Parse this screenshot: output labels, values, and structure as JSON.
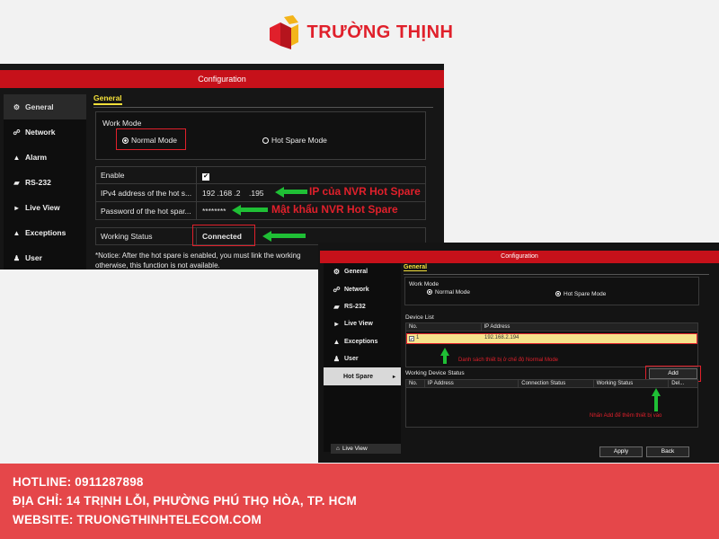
{
  "brand": {
    "name": "TRƯỜNG THỊNH",
    "colors": {
      "primary": "#e0202b",
      "accent": "#f3b41a"
    }
  },
  "shot1": {
    "title": "Configuration",
    "sidebar": [
      {
        "icon": "gear-icon",
        "label": "General"
      },
      {
        "icon": "network-icon",
        "label": "Network"
      },
      {
        "icon": "alarm-icon",
        "label": "Alarm"
      },
      {
        "icon": "serial-icon",
        "label": "RS-232"
      },
      {
        "icon": "liveview-icon",
        "label": "Live View"
      },
      {
        "icon": "warning-icon",
        "label": "Exceptions"
      },
      {
        "icon": "user-icon",
        "label": "User"
      }
    ],
    "tab": "General",
    "work_mode_label": "Work Mode",
    "normal_mode": "Normal Mode",
    "hot_spare_mode": "Hot Spare Mode",
    "rows": [
      {
        "key": "Enable",
        "value": "✔"
      },
      {
        "key": "IPv4 address of the hot s...",
        "value": "192 .168 .2    .195"
      },
      {
        "key": "Password of the hot spar...",
        "value": "********"
      }
    ],
    "working_status_label": "Working Status",
    "working_status_value": "Connected",
    "notice": "*Notice: After the hot spare is enabled, you must link the working\notherwise, this function is not available.",
    "annotations": {
      "ip": "IP của NVR Hot Spare",
      "password": "Mật khẩu NVR Hot Spare"
    }
  },
  "shot2": {
    "title": "Configuration",
    "sidebar": [
      {
        "icon": "gear-icon",
        "label": "General"
      },
      {
        "icon": "network-icon",
        "label": "Network"
      },
      {
        "icon": "serial-icon",
        "label": "RS-232"
      },
      {
        "icon": "liveview-icon",
        "label": "Live View"
      },
      {
        "icon": "warning-icon",
        "label": "Exceptions"
      },
      {
        "icon": "user-icon",
        "label": "User"
      },
      {
        "icon": "",
        "label": "Hot Spare"
      }
    ],
    "sidebar_bottom": "Live View",
    "tab": "General",
    "work_mode_label": "Work Mode",
    "normal_mode": "Normal Mode",
    "hot_spare_mode": "Hot Spare Mode",
    "device_list_label": "Device List",
    "device_list_headers": [
      "No.",
      "IP Address"
    ],
    "device_row": {
      "no": "1",
      "ip": "192.168.2.194"
    },
    "annotation_list": "Danh sách thiết bị ở chế độ Normal Mode",
    "working_device_status_label": "Working Device Status",
    "add_button": "Add",
    "status_headers": [
      "No.",
      "IP Address",
      "Connection Status",
      "Working Status",
      "Del..."
    ],
    "annotation_add": "Nhấn Add để thêm thiết bị vào",
    "apply_button": "Apply",
    "back_button": "Back"
  },
  "footer": {
    "hotline": "HOTLINE: 0911287898",
    "address": "ĐỊA CHỈ: 14 TRỊNH LỖI, PHƯỜNG PHÚ THỌ HÒA, TP. HCM",
    "website": "WEBSITE: TRUONGTHINHTELECOM.COM"
  }
}
